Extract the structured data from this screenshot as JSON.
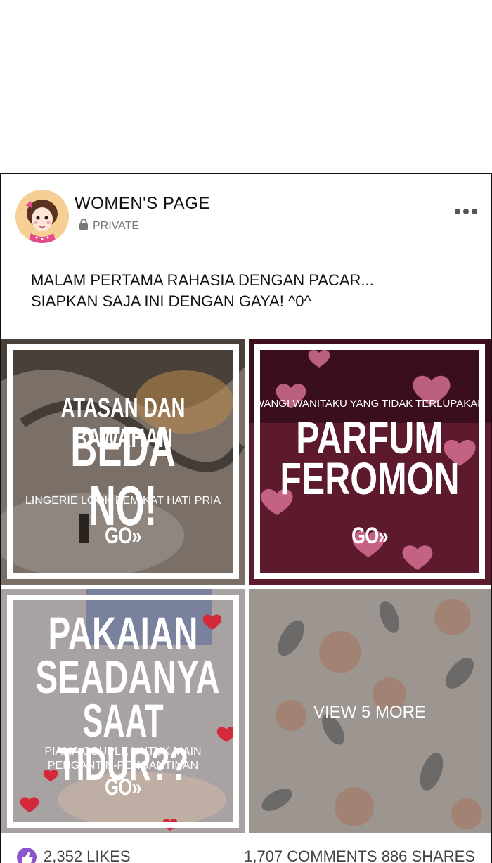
{
  "post": {
    "page_name": "WOMEN'S PAGE",
    "privacy": "PRIVATE",
    "more_icon": "ellipsis-icon",
    "text_line1": "MALAM PERTAMA RAHASIA DENGAN PACAR...",
    "text_line2": "SIAPKAN SAJA INI DENGAN GAYA! ^0^"
  },
  "tiles": [
    {
      "kicker": "ATASAN DAN BAWAHAN",
      "title": "BEDA NO!",
      "subtitle": "LINGERIE LOOK PEMIKAT HATI PRIA",
      "go": "GO»"
    },
    {
      "kicker": "WANGI WANITAKU YANG TIDAK TERLUPAKAN",
      "title_line1": "PARFUM",
      "title_line2": "FEROMON",
      "go": "GO»"
    },
    {
      "title_line1": "PAKAIAN",
      "title_line2": "SEADANYA",
      "title_line3": "SAAT TIDUR??",
      "subtitle_line1": "PIAMA COUPLE UNTUK MAIN",
      "subtitle_line2": "PENGANTIN-PENGANTINAN",
      "go": "GO»"
    },
    {
      "label": "VIEW 5 MORE"
    }
  ],
  "footer": {
    "likes": "2,352 LIKES",
    "comments_shares": "1,707 COMMENTS 886 SHARES"
  }
}
